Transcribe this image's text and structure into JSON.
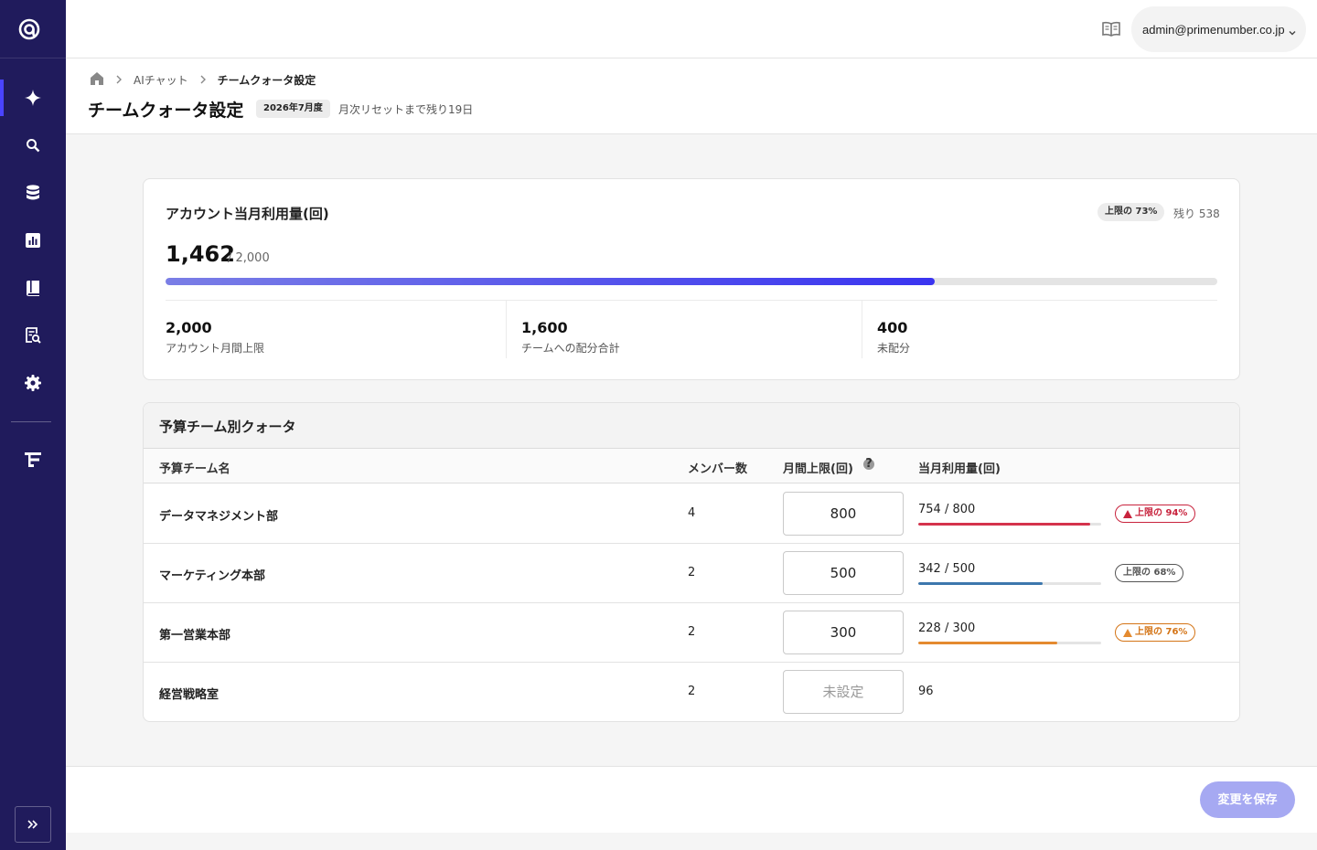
{
  "header": {
    "user_email": "admin@primenumber.co.jp"
  },
  "breadcrumb": {
    "items": [
      "AIチャット",
      "チームクォータ設定"
    ]
  },
  "page": {
    "title": "チームクォータ設定",
    "period": "2026年7月度",
    "reset_note": "月次リセットまで残り19日"
  },
  "usage": {
    "title": "アカウント当月利用量(回)",
    "limit_badge": "上限の 73%",
    "remaining": "残り 538",
    "used": "1,462",
    "total": "/ 2,000",
    "progress": 0.731,
    "stats": [
      {
        "value": "2,000",
        "label": "アカウント月間上限"
      },
      {
        "value": "1,600",
        "label": "チームへの配分合計"
      },
      {
        "value": "400",
        "label": "未配分"
      }
    ]
  },
  "quota": {
    "title": "予算チーム別クォータ",
    "columns": {
      "name": "予算チーム名",
      "members": "メンバー数",
      "limit": "月間上限(回)",
      "used": "当月利用量(回)"
    },
    "rows": [
      {
        "name": "データマネジメント部",
        "members": "4",
        "limit": "800",
        "used": "754 / 800",
        "progress": 0.94,
        "pill": "上限の 94%"
      },
      {
        "name": "マーケティング本部",
        "members": "2",
        "limit": "500",
        "used": "342 / 500",
        "progress": 0.68,
        "pill": "上限の 68%"
      },
      {
        "name": "第一営業本部",
        "members": "2",
        "limit": "300",
        "used": "228 / 300",
        "progress": 0.76,
        "pill": "上限の 76%"
      },
      {
        "name": "経営戦略室",
        "members": "2",
        "limit_placeholder": "未設定",
        "used": "96"
      }
    ]
  },
  "footer": {
    "save_label": "変更を保存"
  },
  "colors": {
    "sidebar": "#201b5c",
    "accent": "#3a34f0",
    "danger": "#d4334c",
    "normal": "#3d77ad",
    "warning": "#e48a2f"
  }
}
